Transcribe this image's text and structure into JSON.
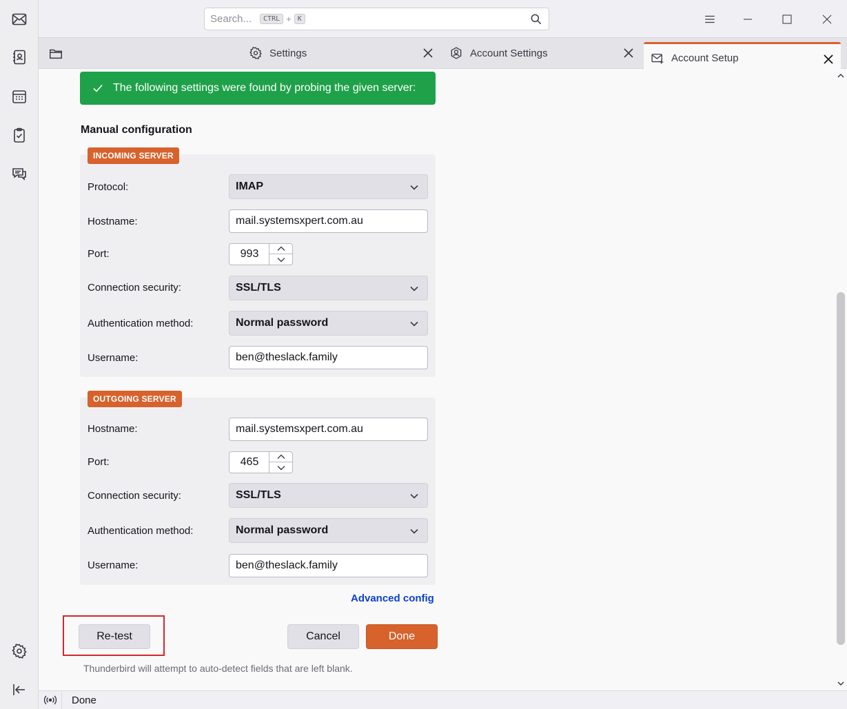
{
  "search": {
    "placeholder": "Search...",
    "key1": "CTRL",
    "plus": "+",
    "key2": "K"
  },
  "tabs": [
    {
      "label": "Settings"
    },
    {
      "label": "Account Settings"
    },
    {
      "label": "Account Setup"
    }
  ],
  "notice": {
    "text": "The following settings were found by probing the given server:"
  },
  "section_title": "Manual configuration",
  "incoming": {
    "badge": "INCOMING SERVER",
    "protocol_label": "Protocol:",
    "protocol_value": "IMAP",
    "hostname_label": "Hostname:",
    "hostname_value": "mail.systemsxpert.com.au",
    "port_label": "Port:",
    "port_value": "993",
    "security_label": "Connection security:",
    "security_value": "SSL/TLS",
    "auth_label": "Authentication method:",
    "auth_value": "Normal password",
    "username_label": "Username:",
    "username_value": "ben@theslack.family"
  },
  "outgoing": {
    "badge": "OUTGOING SERVER",
    "hostname_label": "Hostname:",
    "hostname_value": "mail.systemsxpert.com.au",
    "port_label": "Port:",
    "port_value": "465",
    "security_label": "Connection security:",
    "security_value": "SSL/TLS",
    "auth_label": "Authentication method:",
    "auth_value": "Normal password",
    "username_label": "Username:",
    "username_value": "ben@theslack.family"
  },
  "advanced_link": "Advanced config",
  "buttons": {
    "retest": "Re-test",
    "cancel": "Cancel",
    "done": "Done"
  },
  "hint": "Thunderbird will attempt to auto-detect fields that are left blank.",
  "status": {
    "text": "Done"
  },
  "colors": {
    "accent": "#d7622c",
    "success": "#1fa14a",
    "link": "#0b3fd1",
    "highlight": "#d0282d"
  }
}
